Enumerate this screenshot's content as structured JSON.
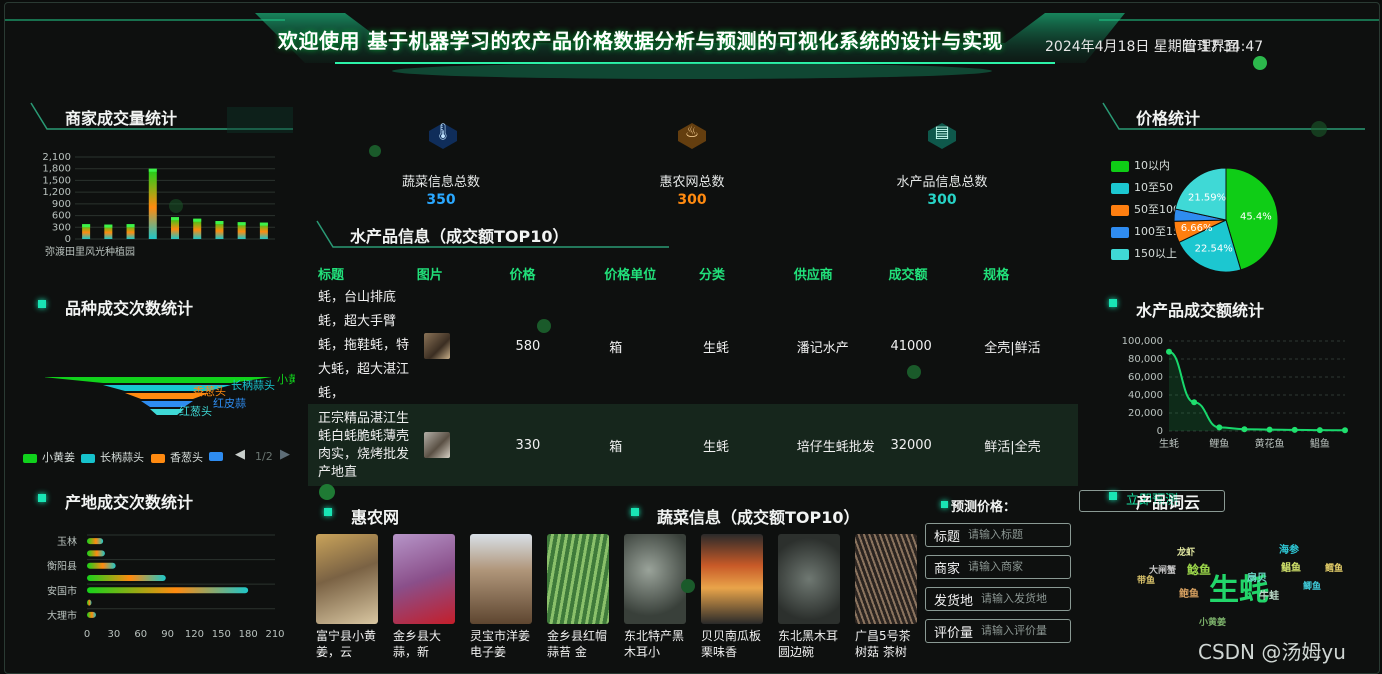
{
  "header": {
    "title": "欢迎使用 基于机器学习的农产品价格数据分析与预测的可视化系统的设计与实现",
    "clock": "2024年4月18日 星期四 17:34:47",
    "admin_link": "管理界面"
  },
  "merchant_volume": {
    "title": "商家成交量统计",
    "chart_data": {
      "type": "bar",
      "categories": [
        "弥渡田里风光种植园",
        "",
        "",
        "",
        "",
        "",
        "",
        "",
        ""
      ],
      "values": [
        380,
        370,
        380,
        1800,
        560,
        520,
        460,
        430,
        420
      ],
      "yticks": [
        "2,100",
        "1,800",
        "1,500",
        "1,200",
        "900",
        "600",
        "300",
        "0"
      ],
      "ylim": [
        0,
        2100
      ]
    }
  },
  "variety_count": {
    "title": "品种成交次数统计",
    "chart_data": {
      "type": "funnel",
      "labels": [
        "小黄姜",
        "长柄蒜头",
        "香葱头",
        "红皮蒜",
        "红葱头"
      ],
      "legend": [
        "小黄姜",
        "长柄蒜头",
        "香葱头"
      ],
      "legend_page": "1/2"
    }
  },
  "origin_count": {
    "title": "产地成交次数统计",
    "chart_data": {
      "type": "bar",
      "categories": [
        "玉林",
        "",
        "衡阳县",
        "",
        "安国市",
        "",
        "大理市"
      ],
      "values": [
        18,
        20,
        32,
        88,
        180,
        5,
        10
      ],
      "xticks": [
        "0",
        "30",
        "60",
        "90",
        "120",
        "150",
        "180",
        "210"
      ],
      "xlim": [
        0,
        210
      ]
    }
  },
  "stats": [
    {
      "label": "蔬菜信息总数",
      "value": "350",
      "color": "#2aa8ff",
      "icon": "thermometer-icon"
    },
    {
      "label": "惠农网总数",
      "value": "300",
      "color": "#ff8a10",
      "icon": "fire-icon"
    },
    {
      "label": "水产品信息总数",
      "value": "300",
      "color": "#27d3c6",
      "icon": "clipboard-icon"
    }
  ],
  "aquatic_table": {
    "title": "水产品信息（成交额TOP10）",
    "headers": [
      "标题",
      "图片",
      "价格",
      "价格单位",
      "分类",
      "供应商",
      "成交额",
      "规格"
    ],
    "rows": [
      {
        "title": "蚝，台山排底蚝，超大手臂蚝，拖鞋蚝，特大蚝，超大湛江蚝，",
        "price": "580",
        "unit": "箱",
        "category": "生蚝",
        "supplier": "潘记水产",
        "amount": "41000",
        "spec": "全壳|鲜活"
      },
      {
        "title": "正宗精品湛江生蚝白蚝脆蚝薄壳肉实，烧烤批发产地直",
        "price": "330",
        "unit": "箱",
        "category": "生蚝",
        "supplier": "培仔生蚝批发",
        "amount": "32000",
        "spec": "鲜活|全壳"
      }
    ]
  },
  "price_stats": {
    "title": "价格统计",
    "chart_data": {
      "type": "pie",
      "labels": [
        "10以内",
        "10至50",
        "50至100",
        "100至150",
        "150以上"
      ],
      "values": [
        45.4,
        22.54,
        6.66,
        3.81,
        21.59
      ],
      "value_labels": [
        "45.4%",
        "22.54%",
        "6.66%",
        "",
        "21.59%"
      ],
      "legend_labels": [
        "10以内",
        "10至50",
        "50至100",
        "100至15",
        "150以上"
      ],
      "colors": [
        "#0fcd16",
        "#1cc7d0",
        "#ff7f10",
        "#2f8cf0",
        "#3fd9d6"
      ]
    }
  },
  "aquatic_amount": {
    "title": "水产品成交额统计",
    "chart_data": {
      "type": "line",
      "x": [
        "生蚝",
        "",
        "鲤鱼",
        "",
        "黄花鱼",
        "",
        "鲳鱼",
        ""
      ],
      "values": [
        88000,
        32000,
        4000,
        2000,
        1500,
        1200,
        1000,
        800
      ],
      "yticks": [
        "100,000",
        "80,000",
        "60,000",
        "40,000",
        "20,000",
        "0"
      ],
      "ylim": [
        0,
        100000
      ]
    }
  },
  "huinong": {
    "title": "惠农网",
    "items": [
      {
        "caption": "富宁县小黄姜，云",
        "color": "#8b7a5c"
      },
      {
        "caption": "金乡县大蒜，新",
        "color": "#a98ba9"
      },
      {
        "caption": "灵宝市洋姜电子姜",
        "color": "#8a6a4a"
      },
      {
        "caption": "金乡县红帽蒜苔 金",
        "color": "#5a8a4a"
      }
    ]
  },
  "vegetables": {
    "title": "蔬菜信息（成交额TOP10）",
    "items": [
      {
        "caption": "东北特产黑木耳小",
        "color": "#6f7a70"
      },
      {
        "caption": "贝贝南瓜板栗味香",
        "color": "#c45a2a"
      },
      {
        "caption": "东北黑木耳 圆边碗",
        "color": "#5e6460"
      },
      {
        "caption": "广昌5号茶树菇 茶树",
        "color": "#4a3a30"
      }
    ]
  },
  "predict": {
    "title": "预测价格：",
    "button": "立即预测",
    "fields": [
      {
        "label": "标题",
        "placeholder": "请输入标题"
      },
      {
        "label": "商家",
        "placeholder": "请输入商家"
      },
      {
        "label": "发货地",
        "placeholder": "请输入发货地"
      },
      {
        "label": "评价量",
        "placeholder": "请输入评价量"
      }
    ]
  },
  "wordcloud": {
    "title": "产品词云",
    "words": [
      "生蚝",
      "鲶鱼",
      "鲳鱼",
      "小黄姜",
      "龙虾",
      "扇贝",
      "海参",
      "鲫鱼",
      "鲍鱼",
      "牛蛙",
      "带鱼",
      "大闸蟹",
      "鳕鱼"
    ]
  },
  "watermark": "CSDN @汤姆yu"
}
